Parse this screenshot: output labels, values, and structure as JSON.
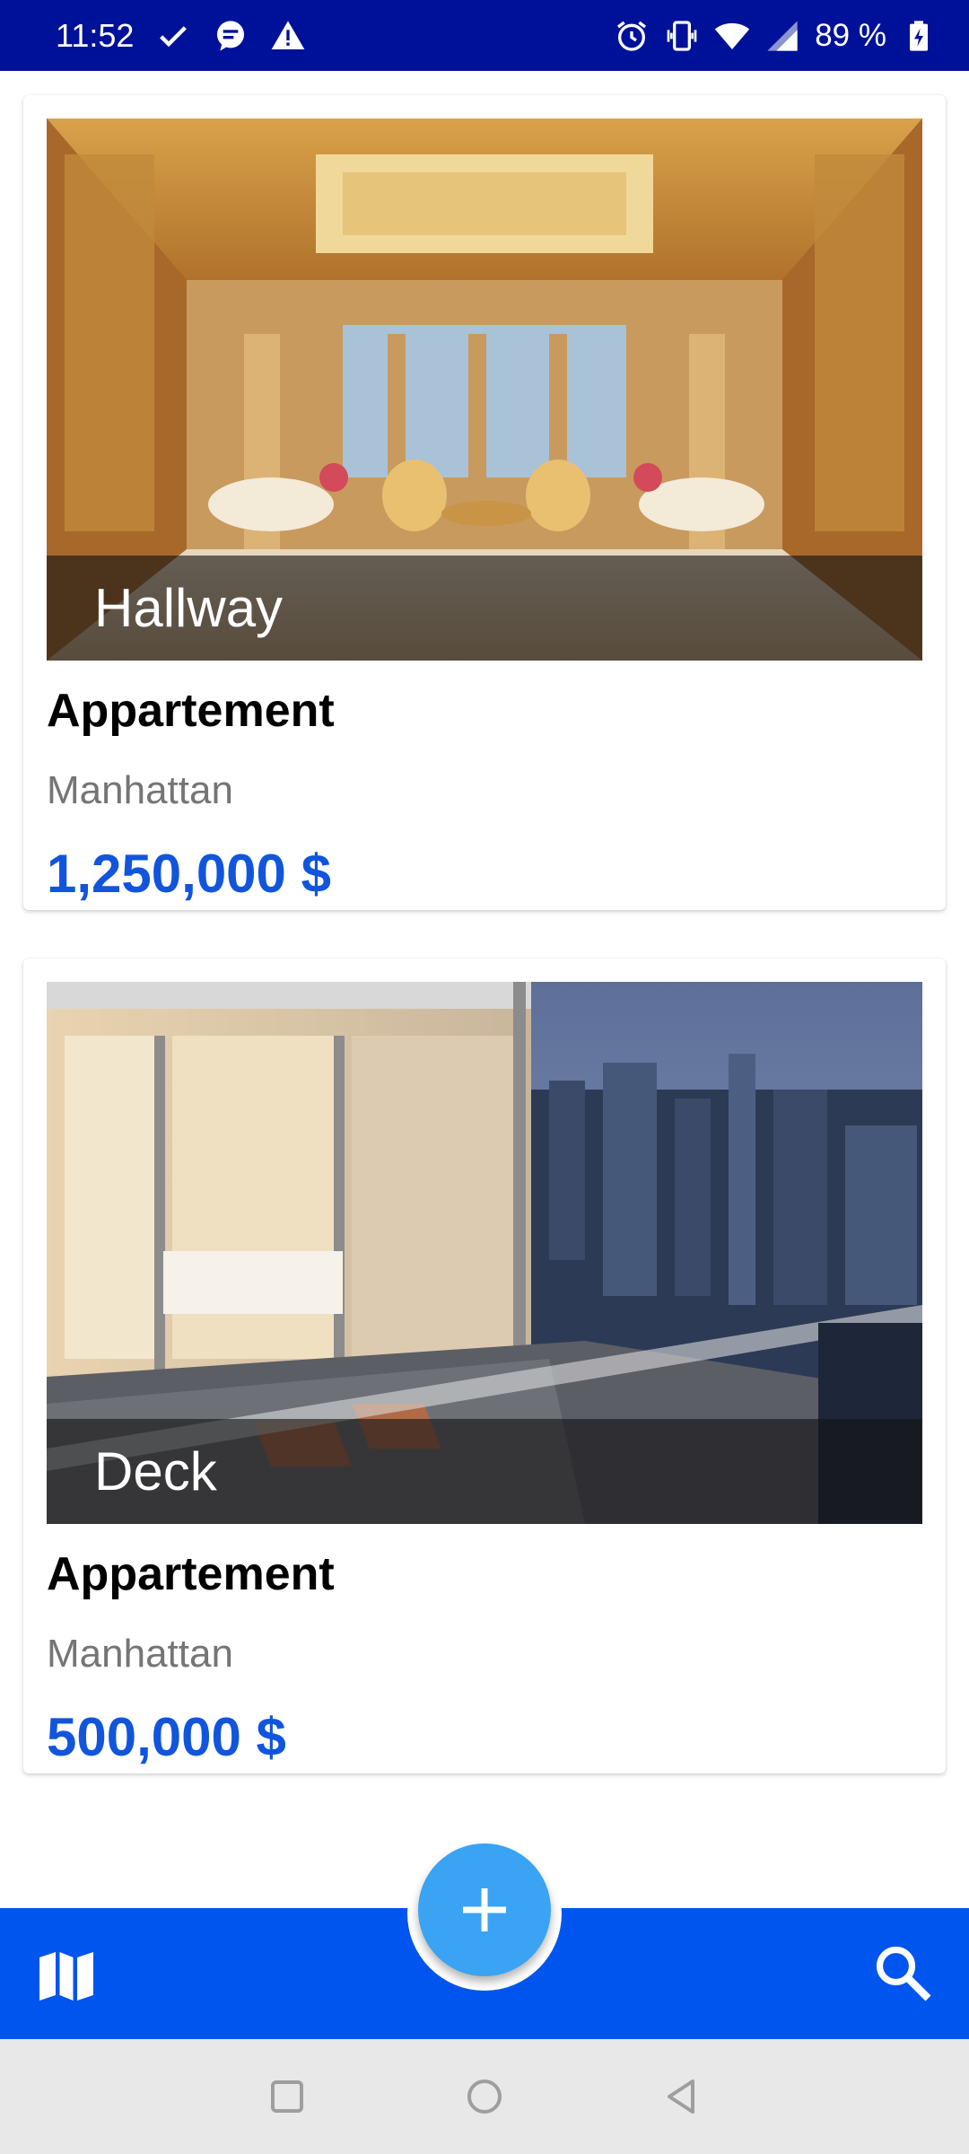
{
  "status_bar": {
    "time": "11:52",
    "battery_text": "89 %",
    "left_icons": [
      "check-icon",
      "message-icon",
      "warning-icon"
    ],
    "right_icons": [
      "alarm-icon",
      "vibrate-icon",
      "wifi-icon",
      "signal-icon",
      "battery-charging-icon"
    ],
    "background_color": "#001199"
  },
  "listings": [
    {
      "image_caption": "Hallway",
      "title": "Appartement",
      "location": "Manhattan",
      "price": "1,250,000 $"
    },
    {
      "image_caption": "Deck",
      "title": "Appartement",
      "location": "Manhattan",
      "price": "500,000 $"
    }
  ],
  "bottom_bar": {
    "left_icon": "map-icon",
    "fab_icon": "plus-icon",
    "right_icon": "search-icon",
    "bar_color": "#0055ee",
    "fab_color": "#3aa3f4"
  },
  "nav_bar": {
    "buttons": [
      "recent-apps-icon",
      "home-icon",
      "back-icon"
    ]
  },
  "colors": {
    "price": "#1155dd",
    "location": "#757575"
  }
}
